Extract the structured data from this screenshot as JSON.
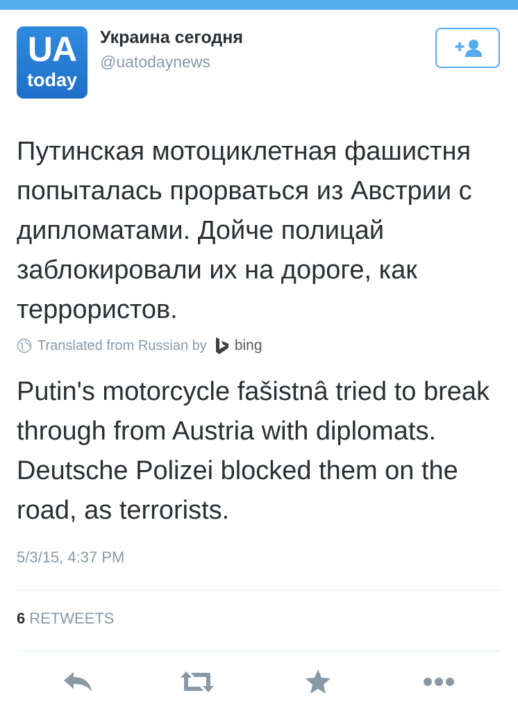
{
  "author": {
    "avatar_text_top": "UA",
    "avatar_text_bottom": "today",
    "name": "Украина сегодня",
    "handle": "@uatodaynews"
  },
  "follow_button": {
    "icon": "add-user-icon"
  },
  "tweet": {
    "original_text": "Путинская мотоциклетная фашистня попыталась прорваться из Австрии с дипломатами. Дойче полицай заблокировали их на дороге, как террористов.",
    "translation_note": "Translated from Russian by",
    "translation_provider": "bing",
    "translated_text": "Putin's motorcycle fašistnâ tried to break through from Austria with diplomats. Deutsche Polizei blocked them on the road, as terrorists.",
    "timestamp": "5/3/15, 4:37 PM"
  },
  "stats": {
    "retweet_count": "6",
    "retweet_label": "RETWEETS"
  },
  "actions": [
    {
      "name": "reply",
      "icon": "reply-icon"
    },
    {
      "name": "retweet",
      "icon": "retweet-icon"
    },
    {
      "name": "favorite",
      "icon": "star-icon"
    },
    {
      "name": "more",
      "icon": "more-icon"
    }
  ],
  "colors": {
    "accent": "#55acee",
    "text": "#292f33",
    "muted": "#8899a6",
    "icon": "#8899a6",
    "avatar_bg": "#1f6fc9"
  }
}
